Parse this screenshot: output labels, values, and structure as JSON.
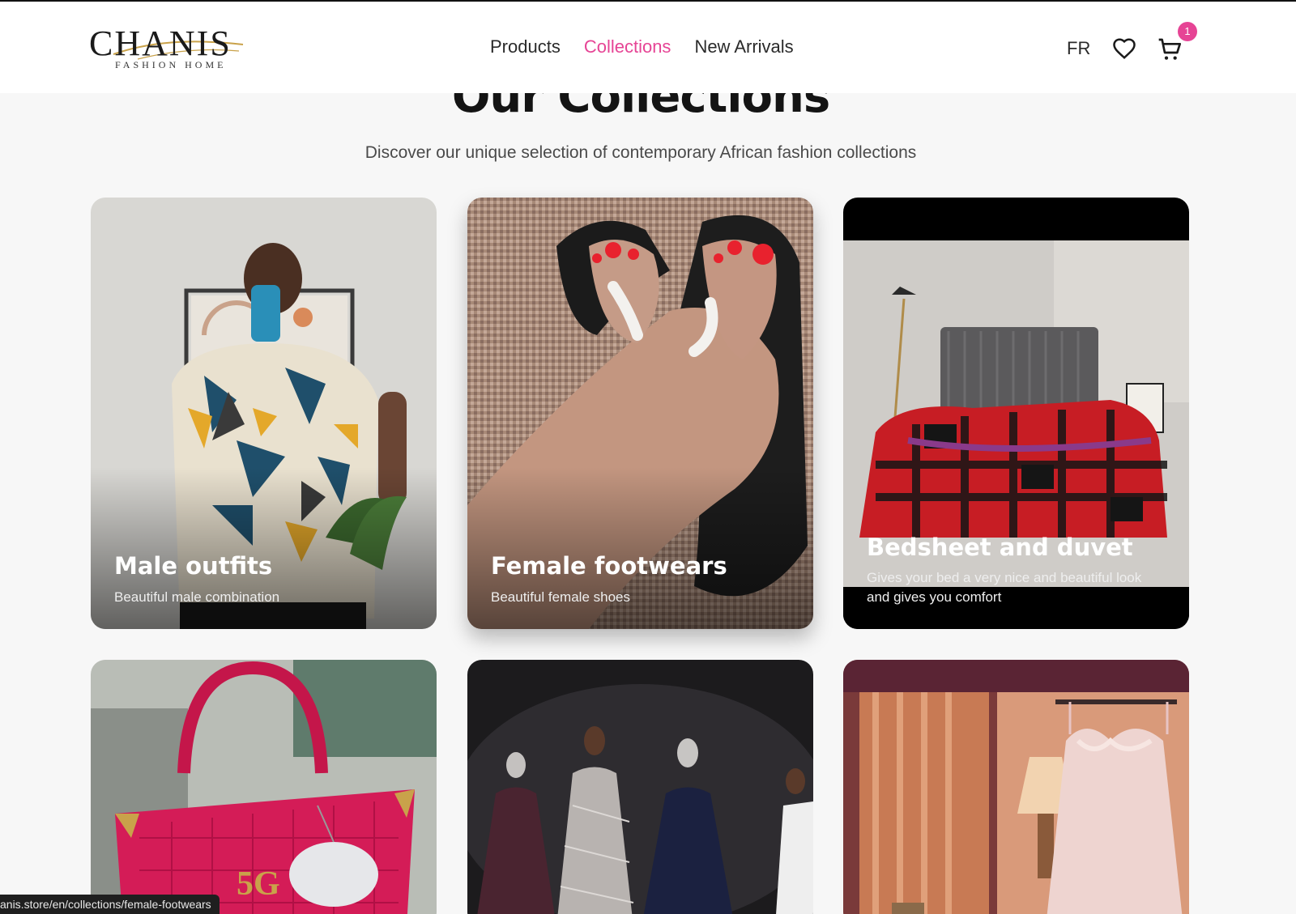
{
  "header": {
    "logo_text": "CHANIS",
    "logo_subtext": "FASHION HOME",
    "nav": [
      {
        "label": "Products",
        "active": false
      },
      {
        "label": "Collections",
        "active": true
      },
      {
        "label": "New Arrivals",
        "active": false
      }
    ],
    "language": "FR",
    "cart_count": "1",
    "icons": [
      "heart-icon",
      "cart-icon"
    ],
    "accent_color": "#e64495"
  },
  "main": {
    "title": "Our Collections",
    "subtitle": "Discover our unique selection of contemporary African fashion collections",
    "collections": [
      {
        "title": "Male outfits",
        "description": "Beautiful male combination"
      },
      {
        "title": "Female footwears",
        "description": "Beautiful female shoes"
      },
      {
        "title": "Bedsheet and duvet",
        "description": "Gives your bed a very nice and beautiful look and gives you comfort"
      },
      {
        "title": "",
        "description": ""
      },
      {
        "title": "",
        "description": ""
      },
      {
        "title": "",
        "description": ""
      }
    ]
  },
  "status_bar": {
    "url": "anis.store/en/collections/female-footwears"
  }
}
